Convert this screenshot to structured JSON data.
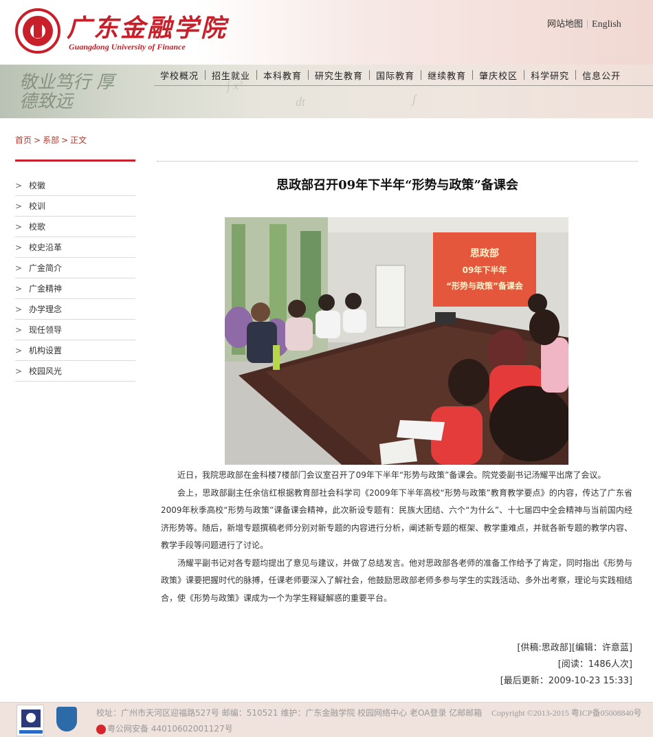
{
  "header": {
    "logo_cn": "广东金融学院",
    "logo_en": "Guangdong University of Finance",
    "top_links": [
      "网站地图",
      "English"
    ]
  },
  "banner": {
    "calligraphy": "敬业笃行 厚德致远"
  },
  "nav": [
    "学校概况",
    "招生就业",
    "本科教育",
    "研究生教育",
    "国际教育",
    "继续教育",
    "肇庆校区",
    "科学研究",
    "信息公开"
  ],
  "breadcrumb": [
    "首页",
    ">",
    "系部",
    ">",
    "正文"
  ],
  "sidebar": [
    "校徽",
    "校训",
    "校歌",
    "校史沿革",
    "广金简介",
    "广金精神",
    "办学理念",
    "现任领导",
    "机构设置",
    "校园风光"
  ],
  "article": {
    "title": "思政部召开09年下半年“形势与政策”备课会",
    "photo_screen_text": [
      "思政部",
      "09年下半年",
      "“形势与政策”备课会"
    ],
    "paragraphs": [
      "近日，我院思政部在金科楼7楼部门会议室召开了09年下半年“形势与政策”备课会。院党委副书记汤耀平出席了会议。",
      "会上，思政部副主任余信红根据教育部社会科学司《2009年下半年高校“形势与政策”教育教学要点》的内容，传达了广东省2009年秋季高校“形势与政策”课备课会精神，此次新设专题有：民族大团结、六个“为什么”、十七届四中全会精神与当前国内经济形势等。随后，新增专题撰稿老师分别对新专题的内容进行分析，阐述新专题的框架、教学重难点，并就各新专题的教学内容、教学手段等问题进行了讨论。",
      "汤耀平副书记对各专题均提出了意见与建议，并做了总结发言。他对思政部各老师的准备工作给予了肯定，同时指出《形势与政策》课要把握时代的脉搏，任课老师要深入了解社会，他鼓励思政部老师多参与学生的实践活动、多外出考察，理论与实践相结合，使《形势与政策》课成为一个为学生释疑解惑的重要平台。"
    ],
    "meta": [
      "[供稿:思政部][编辑：许意蓝]",
      "[阅读：1486人次]",
      "[最后更新：2009-10-23 15:33]"
    ]
  },
  "footer": {
    "line1": "校址：广州市天河区迎福路527号  邮编：510521  维护：广东金融学院 校园网络中心 老OA登录 亿邮邮箱",
    "copyright": "Copyright ©2013-2015 粤ICP备05008840号",
    "line2": "粤公网安备 44010602001127号"
  }
}
